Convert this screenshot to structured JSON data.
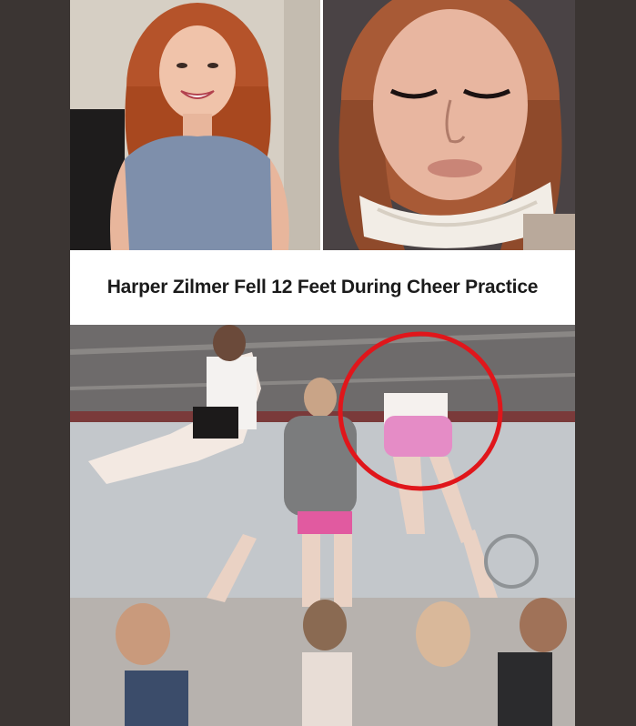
{
  "post": {
    "headline": "Harper Zilmer Fell 12 Feet During Cheer Practice"
  },
  "images": {
    "top_left": "smiling-red-haired-girl-portrait",
    "top_right": "girl-in-neck-brace",
    "bottom": "cheer-stunt-practice"
  },
  "colors": {
    "background": "#3b3533",
    "highlight_circle": "#e0161b",
    "headline_text": "#1b1b1b"
  }
}
